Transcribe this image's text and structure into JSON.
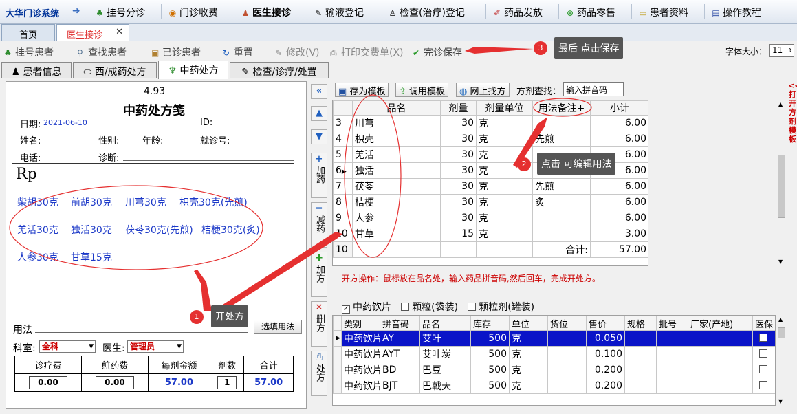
{
  "app": {
    "title": "大华门诊系统"
  },
  "menu": [
    {
      "label": "挂号分诊",
      "icon": "register-icon"
    },
    {
      "label": "门诊收费",
      "icon": "billing-icon"
    },
    {
      "label": "医生接诊",
      "icon": "doctor-icon"
    },
    {
      "label": "输液登记",
      "icon": "infusion-icon"
    },
    {
      "label": "检查(治疗)登记",
      "icon": "exam-icon"
    },
    {
      "label": "药品发放",
      "icon": "medicine-icon"
    },
    {
      "label": "药品零售",
      "icon": "retail-icon"
    },
    {
      "label": "患者资料",
      "icon": "folder-icon"
    },
    {
      "label": "操作教程",
      "icon": "book-icon"
    }
  ],
  "tabs": [
    {
      "label": "首页"
    },
    {
      "label": "医生接诊"
    }
  ],
  "toolbar": {
    "register_patient": "挂号患者",
    "find_patient": "查找患者",
    "seen_patients": "已诊患者",
    "reset": "重置",
    "modify": "修改(V)",
    "print_receipt": "打印交费单(X)",
    "save": "完诊保存",
    "font_size_label": "字体大小：",
    "font_size_value": "11"
  },
  "subtabs": [
    {
      "label": "患者信息"
    },
    {
      "label": "西/成药处方"
    },
    {
      "label": "中药处方"
    },
    {
      "label": "检查/诊疗/处置"
    }
  ],
  "prescription": {
    "amount": "4.93",
    "title": "中药处方笺",
    "date_label": "日期:",
    "date_value": "2021-06-10",
    "id_label": "ID:",
    "name_label": "姓名:",
    "gender_label": "性别:",
    "age_label": "年龄:",
    "visit_no_label": "就诊号:",
    "phone_label": "电话:",
    "diagnosis_label": "诊断:",
    "rp": "Rp",
    "herbs": [
      "柴胡30克",
      "前胡30克",
      "川芎30克",
      "枳壳30克(先煎)",
      "羌活30克",
      "独活30克",
      "茯苓30克(先煎)",
      "桔梗30克(炙)",
      "人参30克",
      "甘草15克"
    ],
    "usage_label": "用法",
    "select_usage_button": "选填用法",
    "department_label": "科室:",
    "department_value": "全科",
    "doctor_label": "医生:",
    "doctor_value": "管理员",
    "fee_headers": [
      "诊疗费",
      "煎药费",
      "每剂金额",
      "剂数",
      "合计"
    ],
    "fee_values": {
      "treatment": "0.00",
      "decoction": "0.00",
      "per_dose": "57.00",
      "doses": "1",
      "total": "57.00"
    }
  },
  "side_buttons": {
    "add": "加药",
    "remove": "减药",
    "add_rx": "加方",
    "delete_rx": "删方",
    "print_rx": "处方"
  },
  "right_toolbar": {
    "save_template": "存为模板",
    "use_template": "调用模板",
    "online_rx": "网上找方",
    "search_label": "方剂查找：",
    "search_value": "输入拼音码"
  },
  "grid1": {
    "headers": [
      "品名",
      "剂量",
      "剂量单位",
      "用法备注+",
      "小计"
    ],
    "rows": [
      {
        "no": "3",
        "name": "川芎",
        "dose": "30",
        "unit": "克",
        "note": "",
        "subtotal": "6.00"
      },
      {
        "no": "4",
        "name": "枳壳",
        "dose": "30",
        "unit": "克",
        "note": "先煎",
        "subtotal": "6.00"
      },
      {
        "no": "5",
        "name": "羌活",
        "dose": "30",
        "unit": "克",
        "note": "",
        "subtotal": "6.00"
      },
      {
        "no": "6",
        "name": "独活",
        "dose": "30",
        "unit": "克",
        "note": "",
        "subtotal": "6.00"
      },
      {
        "no": "7",
        "name": "茯苓",
        "dose": "30",
        "unit": "克",
        "note": "先煎",
        "subtotal": "6.00"
      },
      {
        "no": "8",
        "name": "桔梗",
        "dose": "30",
        "unit": "克",
        "note": "炙",
        "subtotal": "6.00"
      },
      {
        "no": "9",
        "name": "人参",
        "dose": "30",
        "unit": "克",
        "note": "",
        "subtotal": "6.00"
      },
      {
        "no": "10",
        "name": "甘草",
        "dose": "15",
        "unit": "克",
        "note": "",
        "subtotal": "3.00"
      }
    ],
    "total_row_no": "10",
    "total_label": "合计:",
    "total_value": "57.00"
  },
  "hint": "开方操作：鼠标放在品名处，输入药品拼音码,然后回车，完成开处方。",
  "filters": [
    {
      "label": "中药饮片",
      "checked": true
    },
    {
      "label": "颗粒(袋装)",
      "checked": false
    },
    {
      "label": "颗粒剂(罐装)",
      "checked": false
    }
  ],
  "grid2": {
    "headers": [
      "类别",
      "拼音码",
      "品名",
      "库存",
      "单位",
      "货位",
      "售价",
      "规格",
      "批号",
      "厂家(产地)",
      "医保"
    ],
    "rows": [
      {
        "category": "中药饮片",
        "code": "AY",
        "name": "艾叶",
        "stock": "500",
        "unit": "克",
        "price": "0.050"
      },
      {
        "category": "中药饮片",
        "code": "AYT",
        "name": "艾叶炭",
        "stock": "500",
        "unit": "克",
        "price": "0.100"
      },
      {
        "category": "中药饮片",
        "code": "BD",
        "name": "巴豆",
        "stock": "500",
        "unit": "克",
        "price": "0.200"
      },
      {
        "category": "中药饮片",
        "code": "BJT",
        "name": "巴戟天",
        "stock": "500",
        "unit": "克",
        "price": "0.200"
      }
    ]
  },
  "sidebar_link": "<<打开方剂模板",
  "annotations": [
    {
      "num": "1",
      "text": "开处方"
    },
    {
      "num": "2",
      "text": "点击 可编辑用法"
    },
    {
      "num": "3",
      "text": "最后 点击保存"
    }
  ],
  "colors": {
    "accent_red": "#e53030",
    "selection_blue": "#0a14c8",
    "herb_blue": "#1c39c8",
    "callout_gray": "#555555"
  }
}
